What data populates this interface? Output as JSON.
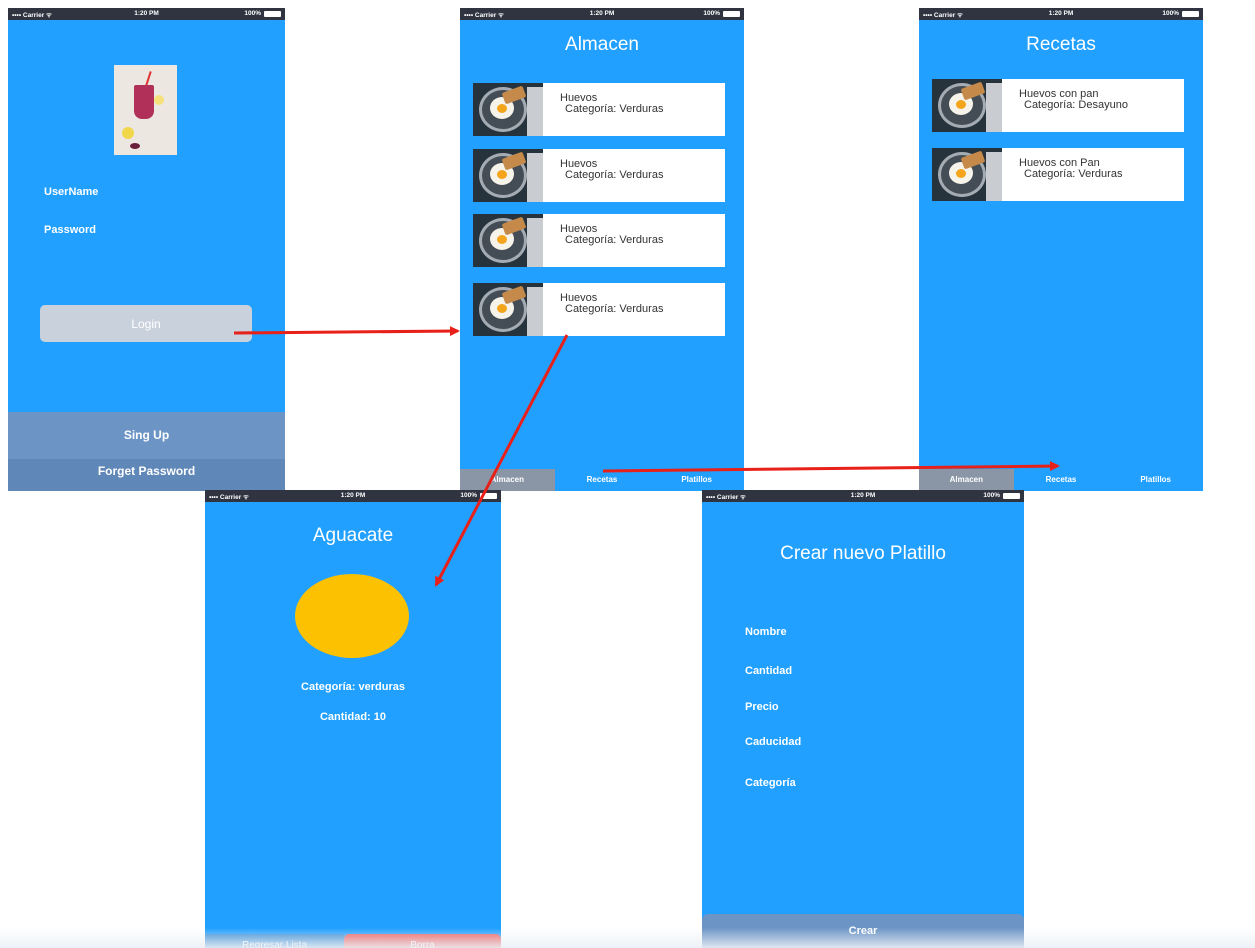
{
  "status_bar": {
    "carrier": "•••• Carrier ᯤ",
    "time": "1:20 PM",
    "battery": "100%"
  },
  "login": {
    "username_label": "UserName",
    "password_label": "Password",
    "login_button": "Login",
    "signup": "Sing Up",
    "forget_password": "Forget Password"
  },
  "almacen": {
    "title": "Almacen",
    "items": [
      {
        "name": "Huevos",
        "category": "Categoría: Verduras"
      },
      {
        "name": "Huevos",
        "category": "Categoría: Verduras"
      },
      {
        "name": "Huevos",
        "category": "Categoría: Verduras"
      },
      {
        "name": "Huevos",
        "category": "Categoría: Verduras"
      }
    ]
  },
  "recetas": {
    "title": "Recetas",
    "items": [
      {
        "name": "Huevos con pan",
        "category": "Categoría: Desayuno"
      },
      {
        "name": "Huevos con Pan",
        "category": "Categoría: Verduras"
      }
    ]
  },
  "tabs": [
    "Almacen",
    "Recetas",
    "Platillos"
  ],
  "aguacate": {
    "title": "Aguacate",
    "category": "Categoría: verduras",
    "quantity": "Cantidad: 10",
    "back_button": "Regresar Lista",
    "delete_button": "Borra",
    "image_color": "#fcc202"
  },
  "crear": {
    "title": "Crear nuevo  Platillo",
    "fields": [
      "Nombre",
      "Cantidad",
      "Precio",
      "Caducidad",
      "Categoría"
    ],
    "create_button": "Crear"
  },
  "colors": {
    "screen_bg": "#22a0ff",
    "arrow": "#e8201a",
    "status_bar": "#2f3440"
  }
}
